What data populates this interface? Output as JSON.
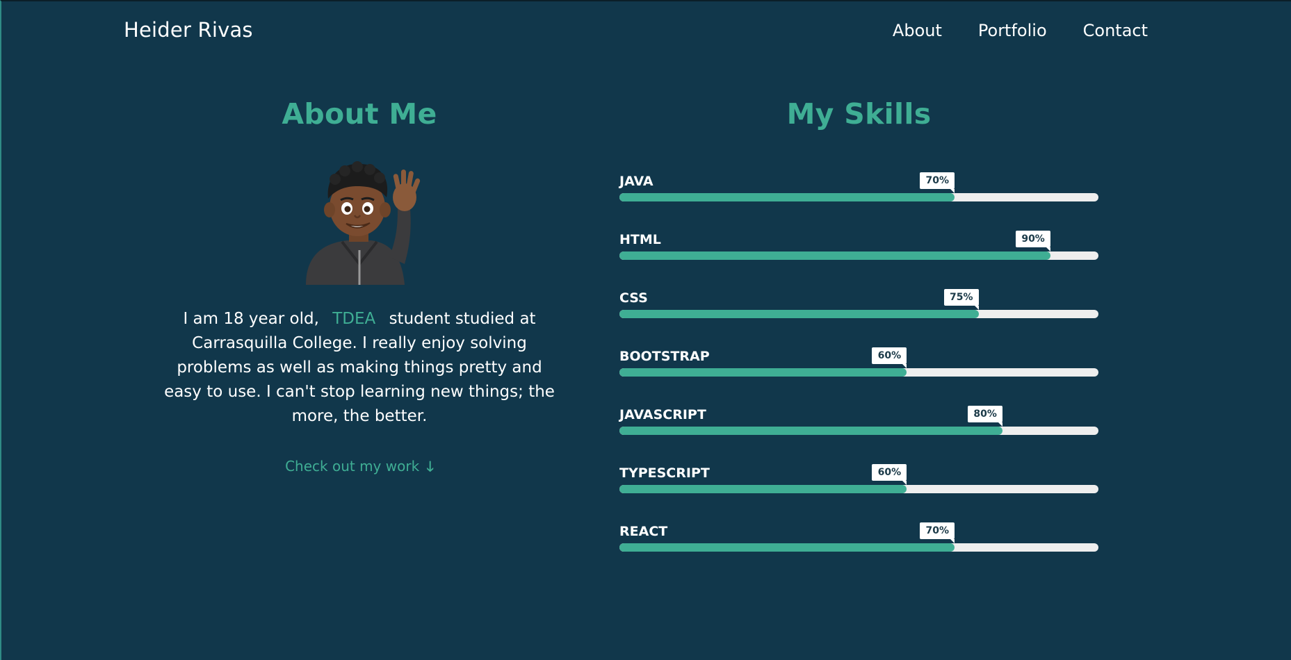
{
  "header": {
    "brand": "Heider Rivas",
    "nav": [
      "About",
      "Portfolio",
      "Contact"
    ]
  },
  "about": {
    "title": "About Me",
    "avatar_icon": "waving-memoji-avatar",
    "text_before": "I am 18 year old,",
    "highlight": "TDEA",
    "text_after": "student studied at Carrasquilla College. I really enjoy solving problems as well as making things pretty and easy to use. I can't stop learning new things; the more, the better.",
    "cta_label": "Check out my work",
    "cta_icon": "arrow-down-icon"
  },
  "skills": {
    "title": "My Skills",
    "items": [
      {
        "name": "JAVA",
        "percent": 70,
        "percent_label": "70%"
      },
      {
        "name": "HTML",
        "percent": 90,
        "percent_label": "90%"
      },
      {
        "name": "CSS",
        "percent": 75,
        "percent_label": "75%"
      },
      {
        "name": "BOOTSTRAP",
        "percent": 60,
        "percent_label": "60%"
      },
      {
        "name": "JAVASCRIPT",
        "percent": 80,
        "percent_label": "80%"
      },
      {
        "name": "TYPESCRIPT",
        "percent": 60,
        "percent_label": "60%"
      },
      {
        "name": "REACT",
        "percent": 70,
        "percent_label": "70%"
      }
    ]
  },
  "colors": {
    "background": "#11374b",
    "accent": "#3fae94",
    "track": "#eeeeee"
  }
}
